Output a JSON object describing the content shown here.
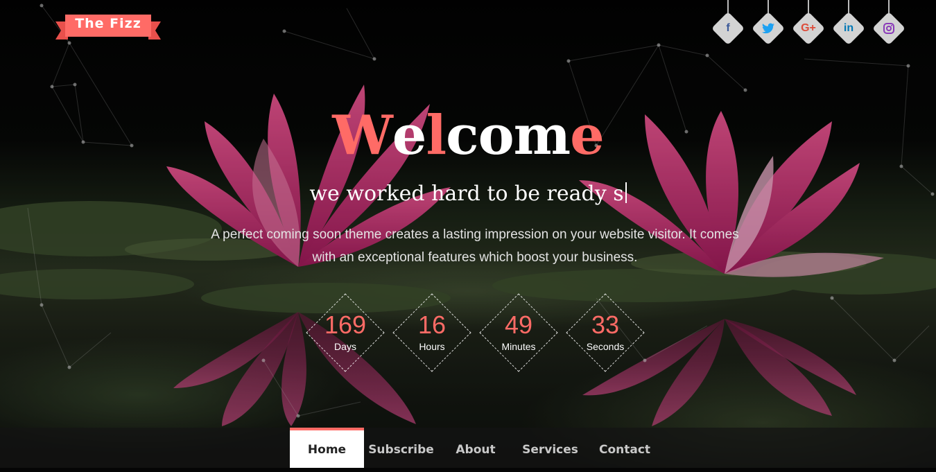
{
  "brand": {
    "name": "The Fizz",
    "accent": "#ff6b66"
  },
  "socials": [
    {
      "icon": "facebook-icon",
      "glyph": "f",
      "color": "#3b5998"
    },
    {
      "icon": "twitter-icon",
      "glyph": "🐦",
      "color": "#1da1f2"
    },
    {
      "icon": "google-plus-icon",
      "glyph": "G+",
      "color": "#dd4b39"
    },
    {
      "icon": "linkedin-icon",
      "glyph": "in",
      "color": "#0077b5"
    },
    {
      "icon": "instagram-icon",
      "glyph": "◎",
      "color": "#8a3ab9"
    }
  ],
  "hero": {
    "title_letters": [
      "W",
      "e",
      "l",
      "c",
      "o",
      "m",
      "e"
    ],
    "title_colors": [
      "#ff6b66",
      "#ffffff",
      "#ff6b66",
      "#ffffff",
      "#ffffff",
      "#ffffff",
      "#ff6b66"
    ],
    "subtitle": "we worked hard to be ready s",
    "description_line1": "A perfect coming soon theme creates a lasting impression on your website visitor. It comes",
    "description_line2": "with an exceptional features which boost your business."
  },
  "countdown": [
    {
      "value": "169",
      "label": "Days"
    },
    {
      "value": "16",
      "label": "Hours"
    },
    {
      "value": "49",
      "label": "Minutes"
    },
    {
      "value": "33",
      "label": "Seconds"
    }
  ],
  "nav": {
    "active": "Home",
    "items": [
      "Home",
      "Subscribe",
      "About",
      "Services",
      "Contact"
    ]
  }
}
